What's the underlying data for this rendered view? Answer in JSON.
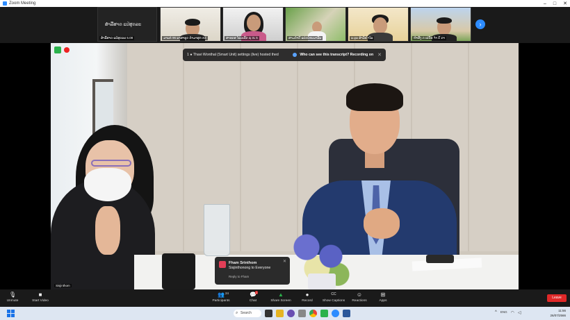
{
  "window": {
    "title": "Zoom Meeting",
    "controls": [
      "–",
      "□",
      "✕"
    ]
  },
  "gallery": {
    "self_tile": {
      "label": "ສຳລີ່ສາດ ແປ່ສຸດລະ",
      "name": "ສຳລີ່ສາດ ແປ່ສຸດລະ 5.08"
    },
    "tiles": [
      {
        "name": "ມາຍດ່ 96 ພາສາທູດ ກຳມາສຸກ ກ3"
      },
      {
        "name": "ສາທດສ ໂພ່ວເທີດ ຊ 3L 5"
      },
      {
        "name": "ສາມດຳດີ ແປດບໍອນມາລັຍ"
      },
      {
        "name": "ນ.ບຸນ ສໍາວິທ ໍາໂລ"
      },
      {
        "name": "ຫໍາສັງ ດ ເປດັທ ຈໍາ ຄີ ດາ"
      }
    ],
    "next_icon": "›"
  },
  "banner": {
    "message": "1 ● Thavi Wonthal (Smart Unit) settings (live) hosted thed",
    "link": "Who can see this transcript? Recording on",
    "close": "✕"
  },
  "chat_popup": {
    "sender": "Fham Srinthom",
    "message": "Sisjinthonong to Everyone",
    "reply": "Reply to Fham",
    "close": "✕"
  },
  "self_label": "Sisjinthom",
  "toolbar": {
    "items": [
      {
        "label": "Unmute",
        "icon": "🎙"
      },
      {
        "label": "Start Video",
        "icon": "■"
      },
      {
        "label": "Participants",
        "icon": "👥",
        "count": "24"
      },
      {
        "label": "Chat",
        "icon": "💬",
        "badge": "1"
      },
      {
        "label": "Share Screen",
        "icon": "▲"
      },
      {
        "label": "Record",
        "icon": "●"
      },
      {
        "label": "Show Captions",
        "icon": "CC"
      },
      {
        "label": "Reactions",
        "icon": "☺"
      },
      {
        "label": "Apps",
        "icon": "⊞"
      }
    ],
    "end_label": "Leave"
  },
  "taskbar": {
    "search_label": "Search",
    "clock": {
      "time": "11:56",
      "date": "26/07/2566"
    },
    "lang": "ENG",
    "colors": {
      "accent": "#1a73e8",
      "zoom_blue": "#2d8cff",
      "end_red": "#e02828"
    }
  }
}
